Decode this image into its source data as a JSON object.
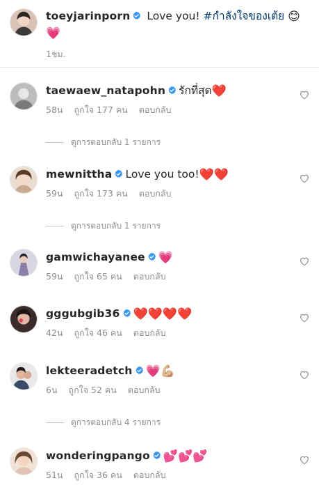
{
  "caption": {
    "username": "toeyjarinporn",
    "text": "Love you! ",
    "hashtag": "#กำลังใจของเต้ย",
    "emoji": "😊 💗",
    "time": "1ชม."
  },
  "comments": [
    {
      "username": "taewaew_natapohn",
      "text": "รักที่สุด",
      "emoji": "❤️",
      "time": "58น",
      "likes": "ถูกใจ 177 คน",
      "reply": "ตอบกลับ",
      "view_replies": "ดูการตอบกลับ 1 รายการ"
    },
    {
      "username": "mewnittha",
      "text": "Love you too!",
      "emoji": "❤️❤️",
      "time": "59น",
      "likes": "ถูกใจ 173 คน",
      "reply": "ตอบกลับ",
      "view_replies": "ดูการตอบกลับ 1 รายการ"
    },
    {
      "username": "gamwichayanee",
      "text": "",
      "emoji": "💗",
      "time": "59น",
      "likes": "ถูกใจ 65 คน",
      "reply": "ตอบกลับ"
    },
    {
      "username": "gggubgib36",
      "text": "",
      "emoji": "❤️❤️❤️❤️",
      "time": "42น",
      "likes": "ถูกใจ 46 คน",
      "reply": "ตอบกลับ"
    },
    {
      "username": "lekteeradetch",
      "text": "",
      "emoji": "💗💪🏼",
      "time": "6น",
      "likes": "ถูกใจ 52 คน",
      "reply": "ตอบกลับ",
      "view_replies": "ดูการตอบกลับ 4 รายการ"
    },
    {
      "username": "wonderingpango",
      "text": "",
      "emoji": "💕💕💕",
      "time": "51น",
      "likes": "ถูกใจ 36 คน",
      "reply": "ตอบกลับ"
    }
  ],
  "colors": {
    "verified": "#3897f0",
    "meta": "#8e8e8e",
    "hashtag": "#00376b"
  },
  "icons": {
    "verified": "verified-badge-icon",
    "like": "heart-outline-icon"
  }
}
